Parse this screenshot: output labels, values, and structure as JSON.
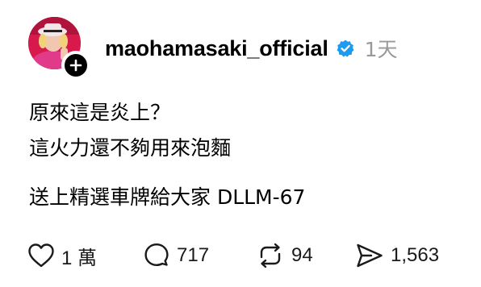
{
  "post": {
    "username": "maohamasaki_official",
    "timestamp": "1天",
    "lines": [
      "原來這是炎上？",
      "這火力還不夠用來泡麵",
      "送上精選車牌給大家 DLLM-67"
    ]
  },
  "actions": {
    "likes": "1 萬",
    "comments": "717",
    "reposts": "94",
    "shares": "1,563"
  },
  "icons": {
    "verified": "verified-badge-icon",
    "follow": "plus-icon",
    "like": "heart-icon",
    "comment": "comment-bubble-icon",
    "repost": "repost-icon",
    "share": "send-icon"
  },
  "colors": {
    "verified": "#1d9bf0",
    "muted": "#999999",
    "text": "#000000",
    "avatar_bg": "#d8194b"
  }
}
